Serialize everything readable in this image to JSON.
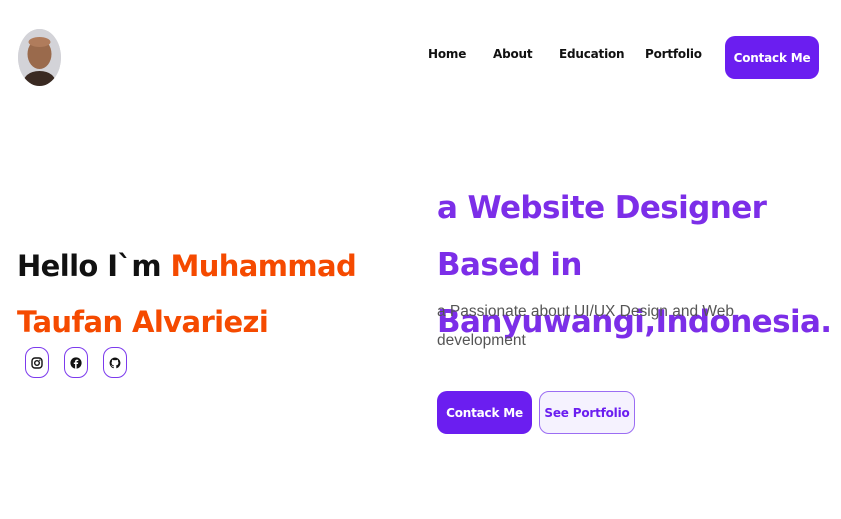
{
  "nav": {
    "items": [
      {
        "label": "Home"
      },
      {
        "label": "About"
      },
      {
        "label": "Education"
      },
      {
        "label": "Portfolio"
      }
    ],
    "contact_label": "Contack Me"
  },
  "hero": {
    "greeting": "Hello I`m ",
    "name": "Muhammad Taufan Alvariezi",
    "headline": "a Website Designer Based in Banyuwangi,Indonesia.",
    "description": "a Passionate about UI/UX Design and Web development",
    "primary_button": "Contack Me",
    "secondary_button": "See Portfolio"
  },
  "social": [
    "instagram-icon",
    "facebook-icon",
    "github-icon"
  ],
  "colors": {
    "accent": "#6b1ef0",
    "headline": "#7c2ee8",
    "name": "#f54a00"
  }
}
